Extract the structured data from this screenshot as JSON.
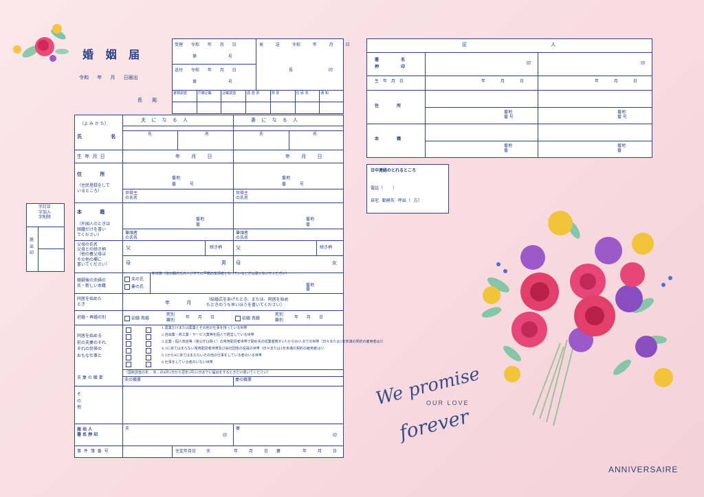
{
  "form": {
    "title": "婚 姻 届",
    "date_line": "令和 年 月 日届出",
    "addressee": "長 殿",
    "receipt": {
      "accepted": "受理 令和 年 月 日",
      "number1": "第 号",
      "sent": "送付 令和 年 月 日",
      "number2": "第 号",
      "forward": "発 送 令和 年 月 日",
      "chief": "長 印"
    },
    "check_cells": [
      "書類調査",
      "戸籍記載",
      "記載調査",
      "調 査 票",
      "附 票",
      "住 民 票",
      "通 知"
    ],
    "left_stamp": {
      "correction": "字訂正\n字加入\n字削除",
      "seal": "届\n出\n印"
    }
  },
  "labels": {
    "yomikata": "（よ み か た）",
    "husband": "夫 に な る 人",
    "wife": "妻 に な る 人",
    "name": "氏 名",
    "sei": "氏",
    "mei": "名",
    "birthdate": "生 年 月 日",
    "ymd": "年 月 日",
    "address": "住 所",
    "address_note": "（住民登録をして\nいるところ）",
    "banchi": "番地",
    "ban": "番 号",
    "household_head": "世帯主\nの氏名",
    "honseki": "本 籍",
    "honseki_note": "（外国人のときは\n国籍だけを書い\nてください）",
    "ban2": "番地\n番",
    "hittousha": "筆頭者\nの氏名",
    "parents": "父母の氏名\n父母との続き柄\n（他の養父母は\nその他の欄に\n書いてください）",
    "father": "父",
    "mother": "母",
    "relation": "続き柄",
    "son": "男",
    "daughter": "女",
    "new_surname_label": "婚姻後の夫婦の\n氏・新しい本籍",
    "husband_surname": "夫の氏",
    "wife_surname": "妻の氏",
    "new_honseki": "新本籍（左の欄の氏の人がすでに戸籍の筆頭者となっているときは書かないでください）",
    "cohabit_label": "同居を始めた\nとき",
    "cohabit_value": "年 月",
    "cohabit_note": "（結婚式をあげたとき、または、同居を始め\nたときのうち早いほうを書いてください）",
    "first_marriage_label": "初婚・再婚の別",
    "first_marriage": "初婚 再婚",
    "death_divorce": "死別\n離別",
    "occupation_label": "同居を始める\n前の夫妻のそれ\nぞれの世帯の\nおもな仕事と",
    "occupations": [
      "1.農業だけまたは農業とその他の仕事を持っている世帯",
      "2.自由業・商工業・サービス業等を個人で経営している世帯",
      "3.企業・個人商店等（官公庁は除く）の常用勤労者世帯で勤め先の従業者数が1人から99人までの世帯（日々または1年未満の契約の雇用者は5）",
      "4.3にあてはまらない常用勤労者世帯及び会社団体の役員の世帯（日々または1年未満の契約の雇用者は5）",
      "5.1から4にあてはまらないその他の仕事をしている者のいる世帯",
      "6.仕事をしている者のいない世帯"
    ],
    "census_note": "（国勢調査の年… 年…の4月1日から翌年3月31日までに届出をするときだけ書いてください）",
    "couple_job_label": "夫 妻 の 職 業",
    "husband_job": "夫の職業",
    "wife_job": "妻の職業",
    "other": "そ\nの\n他",
    "signer_label": "届 出 人\n署 名 押 印",
    "husband_short": "夫",
    "wife_short": "妻",
    "seal": "印",
    "case_no": "事 件 簿 番 号",
    "residence_date": "住定年月日",
    "tsuma_date_h": "夫",
    "tsuma_date_w": "妻"
  },
  "witness": {
    "title": "証 人",
    "signature": "署 名\n押 印",
    "seal": "印",
    "birth": "生 年 月 日",
    "ymd": "年 月 日",
    "address": "住 所",
    "honseki": "本 籍",
    "banchi": "番地\n番 号",
    "banchi2": "番地\n番"
  },
  "contact": {
    "title": "日中連絡のとれるところ",
    "phone": "電話（ ）",
    "places": "自宅 勤務先 呼出（ 方）"
  },
  "decor": {
    "script1": "We promise",
    "script2": "OUR LOVE",
    "script3": "forever",
    "brand": "ANNIVERSAIRE"
  }
}
